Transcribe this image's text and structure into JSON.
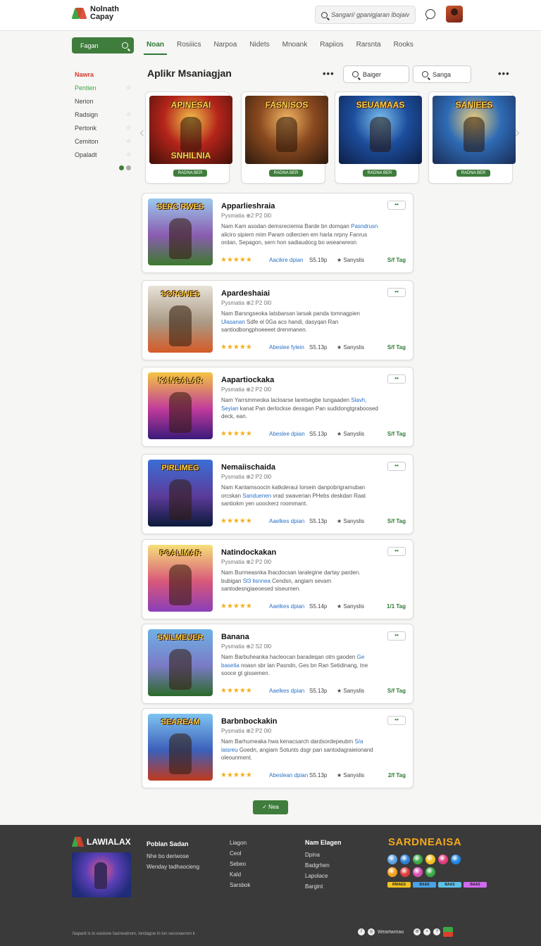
{
  "header": {
    "brand_line1": "Nolnath",
    "brand_line2": "Capay",
    "search_placeholder": "Sangari/ gpanigjaran lbojaiv"
  },
  "nav": {
    "side_search_label": "Fagan",
    "tabs": [
      "Noan",
      "Rosiiics",
      "Narpoa",
      "Nidets",
      "Mnoank",
      "Rapiios",
      "Rarsnta",
      "Rooks"
    ],
    "active_tab": 0
  },
  "sidebar": {
    "items": [
      {
        "label": "Nawra",
        "star": ""
      },
      {
        "label": "Pentien",
        "star": "☆"
      },
      {
        "label": "Nerion",
        "star": ""
      },
      {
        "label": "Radsign",
        "star": "☆"
      },
      {
        "label": "Pertonk",
        "star": "☆"
      },
      {
        "label": "Cemiton",
        "star": "☆"
      },
      {
        "label": "Opaladt",
        "star": "☆"
      }
    ]
  },
  "section": {
    "title": "Aplikr Msaniagjan",
    "filter1": "Baiger",
    "filter2": "Sanga"
  },
  "featured": [
    {
      "title": "APINESAI",
      "subtitle": "SNHILNIA",
      "button": "RADNA BER",
      "colors": [
        "#f2c24a",
        "#b4241a",
        "#401008"
      ]
    },
    {
      "title": "FASNISOS",
      "subtitle": "",
      "button": "RADNA BER",
      "colors": [
        "#f4b765",
        "#8b4a1f",
        "#2d1a0e"
      ]
    },
    {
      "title": "SEUAMAAS",
      "subtitle": "",
      "button": "RADNA BER",
      "colors": [
        "#7ac0ef",
        "#1c4d9c",
        "#0d1f46"
      ]
    },
    {
      "title": "SANIEES",
      "subtitle": "",
      "button": "RADNA BER",
      "colors": [
        "#f2d07a",
        "#2e6bb5",
        "#1a2c55"
      ]
    }
  ],
  "apps": [
    {
      "name": "Apparlieshraia",
      "meta": "Pysmatia  ⊕2 P2 0l0",
      "desc1": "Nam Kam asodan demsreciemia Barde bn domqan",
      "desc_hl": "Pasndrusn",
      "desc2": "aliciro sipiern mim Param odlercien em harla nrpny Fanrus ordan, Sepagon, sern hon sadiaudocg bo wsearwreon",
      "rating": "★★★★★",
      "dl": "Aacikre dpian",
      "size": "S5.19p",
      "sv": "★ Sanyslis",
      "ag": "S/f Tag",
      "more": "••",
      "art_title": "SERC RWES",
      "art_colors": [
        "#9cc9ed",
        "#8a5cb0",
        "#3d7a2d"
      ]
    },
    {
      "name": "Apardeshaiai",
      "meta": "Pysmatia  ⊕2 P2 0l0",
      "desc1": "Nam Barsngseoka latsbarsan larsak panda tomnagpien",
      "desc_hl": "Ulasanan",
      "desc2": "Sdfe el 0Ga acs handi, dasyqan Ran santiodbongphoeeeet drenmanen.",
      "rating": "★★★★★",
      "dl": "Abeslee fylein",
      "size": "S5.13p",
      "sv": "★ Sanyslis",
      "ag": "S/f Tag",
      "more": "••",
      "art_title": "SORONES",
      "art_colors": [
        "#e8e2d8",
        "#aa9a85",
        "#d55a27"
      ]
    },
    {
      "name": "Aapartiockaka",
      "meta": "Pysmatia  ⊕2 P2 0l0",
      "desc1": "Nam Yarrsmmeoka lacloarse laretsegbe tungaaden",
      "desc_hl": "Slavh, Seyian",
      "desc2": "kanat Pan derlockse dessgan Pan sudidongtgraboosed deck, ean.",
      "rating": "★★★★★",
      "dl": "Abeslee dpian",
      "size": "S5.13p",
      "sv": "★ Sanyslis",
      "ag": "S/f Tag",
      "more": "••",
      "art_title": "KANGALAR",
      "art_colors": [
        "#f5c542",
        "#c03a9c",
        "#3a1a7a"
      ]
    },
    {
      "name": "Nemaiischaida",
      "meta": "Pysmatia  ⊕2 P2 0l0",
      "desc1": "Nam Kantamsoocin katkderaui lorsein danpobrigramuban orcskan",
      "desc_hl": "Sanduenen",
      "desc2": "vrad swaverian PHebs deskdan Raat santiokm yen uoockerz roommant.",
      "rating": "★★★★★",
      "dl": "Aaelkes dpian",
      "size": "S5.13p",
      "sv": "★ Sanyslis",
      "ag": "S/f Tag",
      "more": "••",
      "art_title": "PIRLIMEG",
      "art_colors": [
        "#3b6fd6",
        "#5c3b9a",
        "#0c1a3a"
      ]
    },
    {
      "name": "Natindockakan",
      "meta": "Pysmatia  ⊕2 P2 0l0",
      "desc1": "Nam Burmeasnka lhacdocsan laralegine dartay parden. bubigan",
      "desc_hl": "Sl3 lisnnea",
      "desc2": "Cendsn, angiam sevam santodesngiaeoesed siseumen.",
      "rating": "★★★★★",
      "dl": "Aaelkes dpian",
      "size": "S5.14p",
      "sv": "★ Sanyslis",
      "ag": "1/1 Tag",
      "more": "••",
      "art_title": "POALIMAR",
      "art_colors": [
        "#f6e07a",
        "#d8577a",
        "#8a3fb8"
      ]
    },
    {
      "name": "Banana",
      "meta": "Pysmatia  ⊕2 S2 0l0",
      "desc1": "Nam Barbuheanka hacleocan baradeqan otm gaoden",
      "desc_hl": "Ge basetia",
      "desc2": "noasn sbr lan Pasndn, Ges bn Ran Setidinang, tne sooce gt gissemen.",
      "rating": "★★★★★",
      "dl": "Aaelkes dpian",
      "size": "S5.13p",
      "sv": "★ Sanyslis",
      "ag": "S/f Tag",
      "more": "••",
      "art_title": "SNILMEUER",
      "art_colors": [
        "#6fb1e6",
        "#7a7ac5",
        "#2c6a2a"
      ]
    },
    {
      "name": "Barbnbockakin",
      "meta": "Pysmatia  ⊕2 P2 0l0",
      "desc1": "Nam Barhumeaka hwa kenacsarch dardsordepeubm",
      "desc_hl": "S/a laisreu",
      "desc2": "Goedn, angiam Sotunts dsgr pan santodagraieionand oleounment.",
      "rating": "★★★★★",
      "dl": "Abeslean dpian",
      "size": "S5.13p",
      "sv": "★ Sanyslis",
      "ag": "2/f Tag",
      "more": "••",
      "art_title": "SEAREAM",
      "art_colors": [
        "#7ec4f2",
        "#3c5fb8",
        "#c23a1e"
      ]
    }
  ],
  "load_more": "✓ Nea",
  "footer": {
    "brand": "LAWIALAX",
    "col1": {
      "title": "Poblan Sadan",
      "items": [
        "Nhe bo deriwose",
        "Wenday tadhaocieng"
      ]
    },
    "col2": {
      "title": "",
      "items": [
        "Liagon",
        "Ceol",
        "Sebeo",
        "Kald",
        "Sarsbok"
      ]
    },
    "col3": {
      "title": "Nam Elagen",
      "items": [
        "Dpina",
        "Badgrhen",
        "Lapolace",
        "Bargint"
      ]
    },
    "brand2": "SARDNEAISA",
    "social_colors": [
      "#5aa0e0",
      "#2c7fd6",
      "#3aa845",
      "#f2c21e",
      "#e03b7a",
      "#1e88e5",
      "#f29f1e",
      "#e03b3b",
      "#d94fb0",
      "#3aa845"
    ],
    "stores": [
      {
        "label": "RNIAES",
        "color": "#f2c21e"
      },
      {
        "label": "BAAS",
        "color": "#4aa3e8"
      },
      {
        "label": "BAAS",
        "color": "#5fc0e8"
      },
      {
        "label": "BAAS",
        "color": "#d26af0"
      }
    ],
    "copyright": "Napartt is to eastone fasmeatnom, londagne tn lon seconaerom k",
    "right_text": "Weartwmao"
  }
}
